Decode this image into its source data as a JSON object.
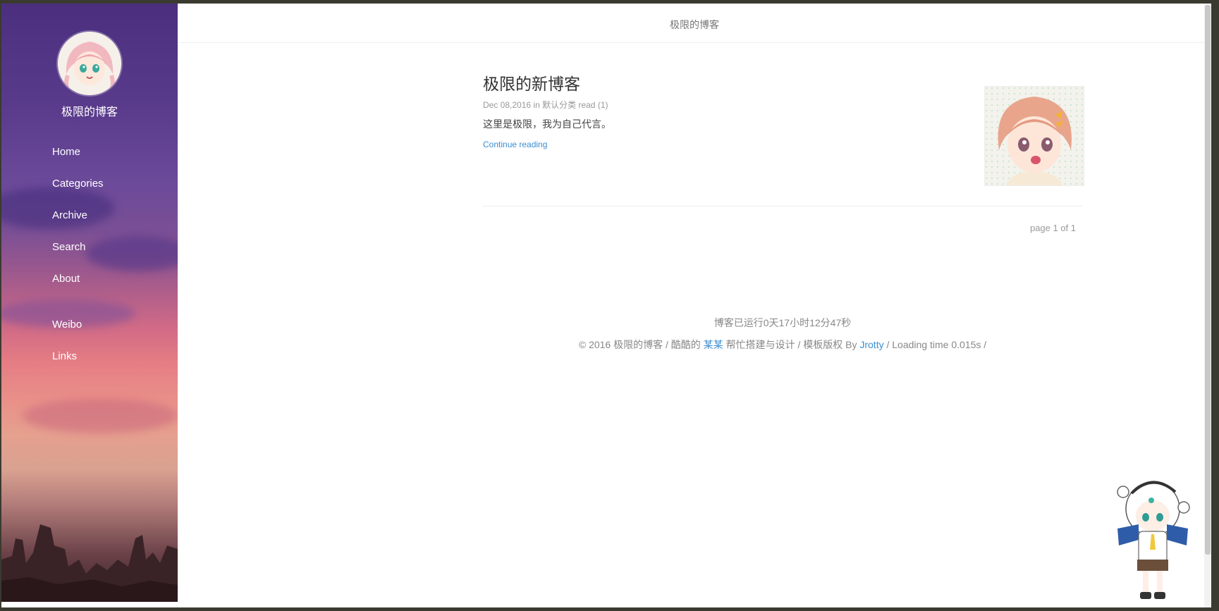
{
  "sidebar": {
    "blog_name": "极限的博客",
    "nav": [
      {
        "label": "Home"
      },
      {
        "label": "Categories"
      },
      {
        "label": "Archive"
      },
      {
        "label": "Search"
      },
      {
        "label": "About"
      }
    ],
    "social": [
      {
        "label": "Weibo"
      },
      {
        "label": "Links"
      }
    ]
  },
  "header": {
    "title": "极限的博客"
  },
  "post": {
    "title": "极限的新博客",
    "date": "Dec 08,2016",
    "in_word": "in",
    "category": "默认分类",
    "read_label": "read",
    "read_count": "(1)",
    "excerpt": "这里是极限，我为自己代言。",
    "continue_label": "Continue reading"
  },
  "pager": {
    "text": "page 1 of 1"
  },
  "footer": {
    "runtime": "博客已运行0天17小时12分47秒",
    "copyright_prefix": "© 2016 极限的博客 / 酷酷的",
    "designer_link": "某某",
    "middle": "帮忙搭建与设计 / 模板版权 By",
    "template_link": "Jrotty",
    "suffix": "/ Loading time 0.015s /"
  },
  "colors": {
    "accent_link": "#3b8dd0",
    "sidebar_top": "#4b2f7e",
    "sidebar_mid": "#e57d84"
  }
}
